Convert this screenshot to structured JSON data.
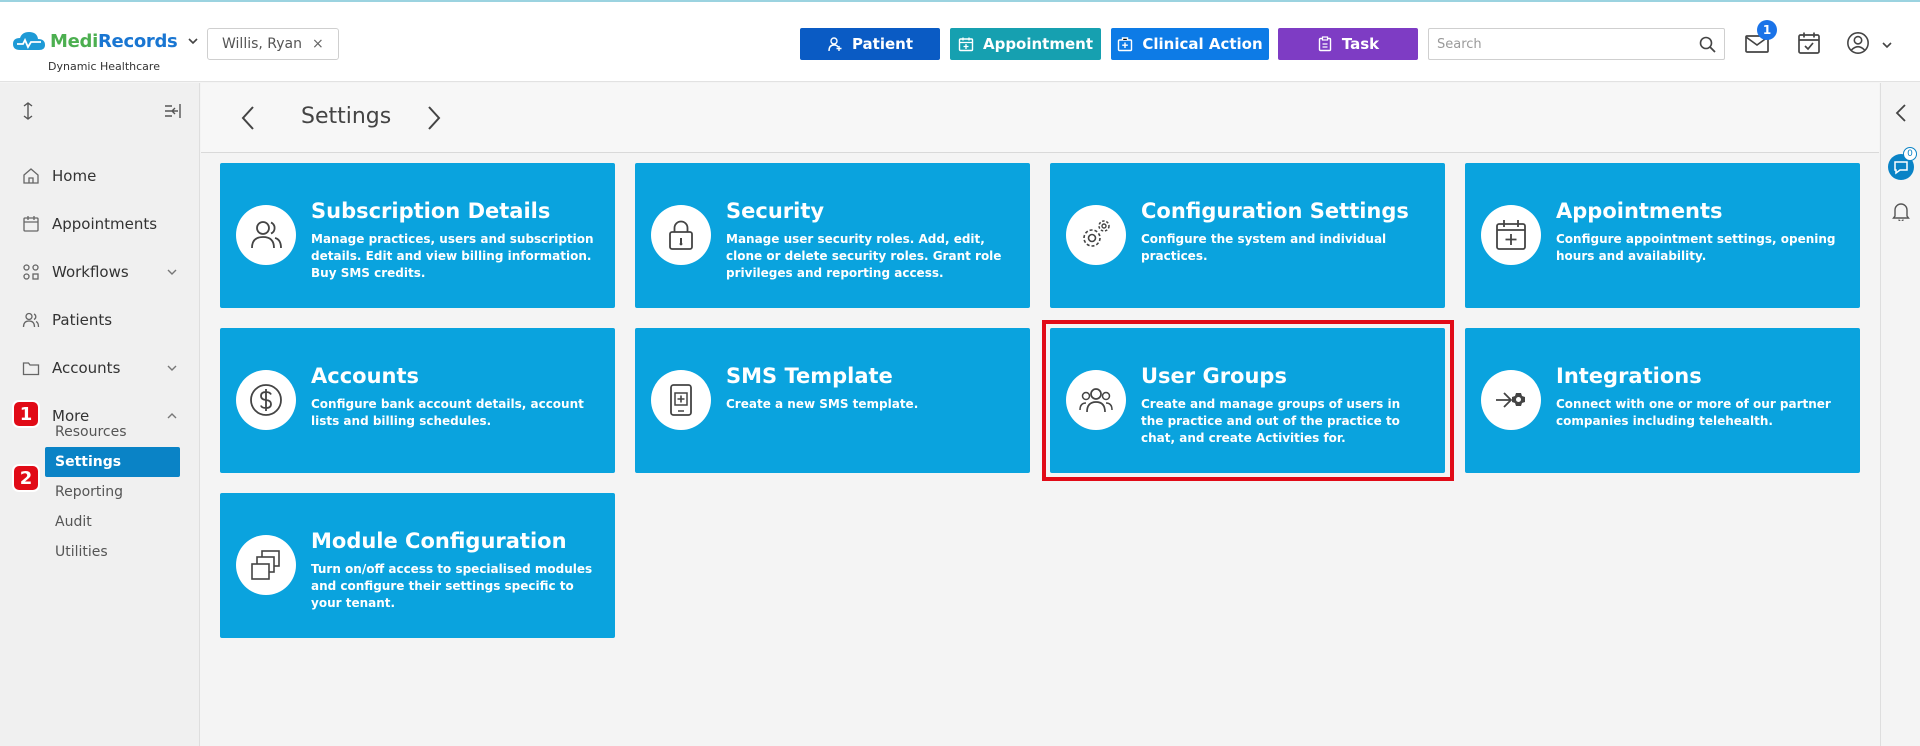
{
  "brand": {
    "name_part1": "Medi",
    "name_part2": "Records",
    "subtitle": "Dynamic Healthcare"
  },
  "patient_chip": {
    "name": "Willis, Ryan",
    "close": "×"
  },
  "actions": {
    "patient": "Patient",
    "appointment": "Appointment",
    "clinical": "Clinical Action",
    "task": "Task"
  },
  "search": {
    "placeholder": "Search"
  },
  "notifications": {
    "mail_count": "1"
  },
  "sidebar": {
    "items": [
      {
        "label": "Home"
      },
      {
        "label": "Appointments"
      },
      {
        "label": "Workflows"
      },
      {
        "label": "Patients"
      },
      {
        "label": "Accounts"
      },
      {
        "label": "More"
      }
    ],
    "sub_items": [
      {
        "label": "Resources"
      },
      {
        "label": "Settings"
      },
      {
        "label": "Reporting"
      },
      {
        "label": "Audit"
      },
      {
        "label": "Utilities"
      }
    ],
    "step_badges": [
      "1",
      "2"
    ]
  },
  "page": {
    "title": "Settings"
  },
  "tiles": [
    {
      "title": "Subscription Details",
      "desc": "Manage practices, users and subscription details. Edit and view billing information. Buy SMS credits.",
      "icon": "users-icon"
    },
    {
      "title": "Security",
      "desc": "Manage user security roles. Add, edit, clone or delete security roles. Grant role privileges and reporting access.",
      "icon": "lock-icon"
    },
    {
      "title": "Configuration Settings",
      "desc": "Configure the system and individual practices.",
      "icon": "gears-icon"
    },
    {
      "title": "Appointments",
      "desc": "Configure appointment settings, opening hours and availability.",
      "icon": "calendar-plus-icon"
    },
    {
      "title": "Accounts",
      "desc": "Configure bank account details, account lists and billing schedules.",
      "icon": "dollar-icon"
    },
    {
      "title": "SMS Template",
      "desc": "Create a new SMS template.",
      "icon": "phone-plus-icon"
    },
    {
      "title": "User Groups",
      "desc": "Create and manage groups of users in the practice and out of the practice to chat, and create Activities for.",
      "icon": "group-icon"
    },
    {
      "title": "Integrations",
      "desc": "Connect with one or more of our partner companies including telehealth.",
      "icon": "integration-icon"
    },
    {
      "title": "Module Configuration",
      "desc": "Turn on/off access to specialised modules and configure their settings specific to your tenant.",
      "icon": "modules-icon"
    }
  ],
  "right_rail": {
    "chat_count": "0"
  },
  "colors": {
    "tile": "#0aa3de",
    "highlight": "#e10b17",
    "active_nav": "#0a83c6"
  }
}
